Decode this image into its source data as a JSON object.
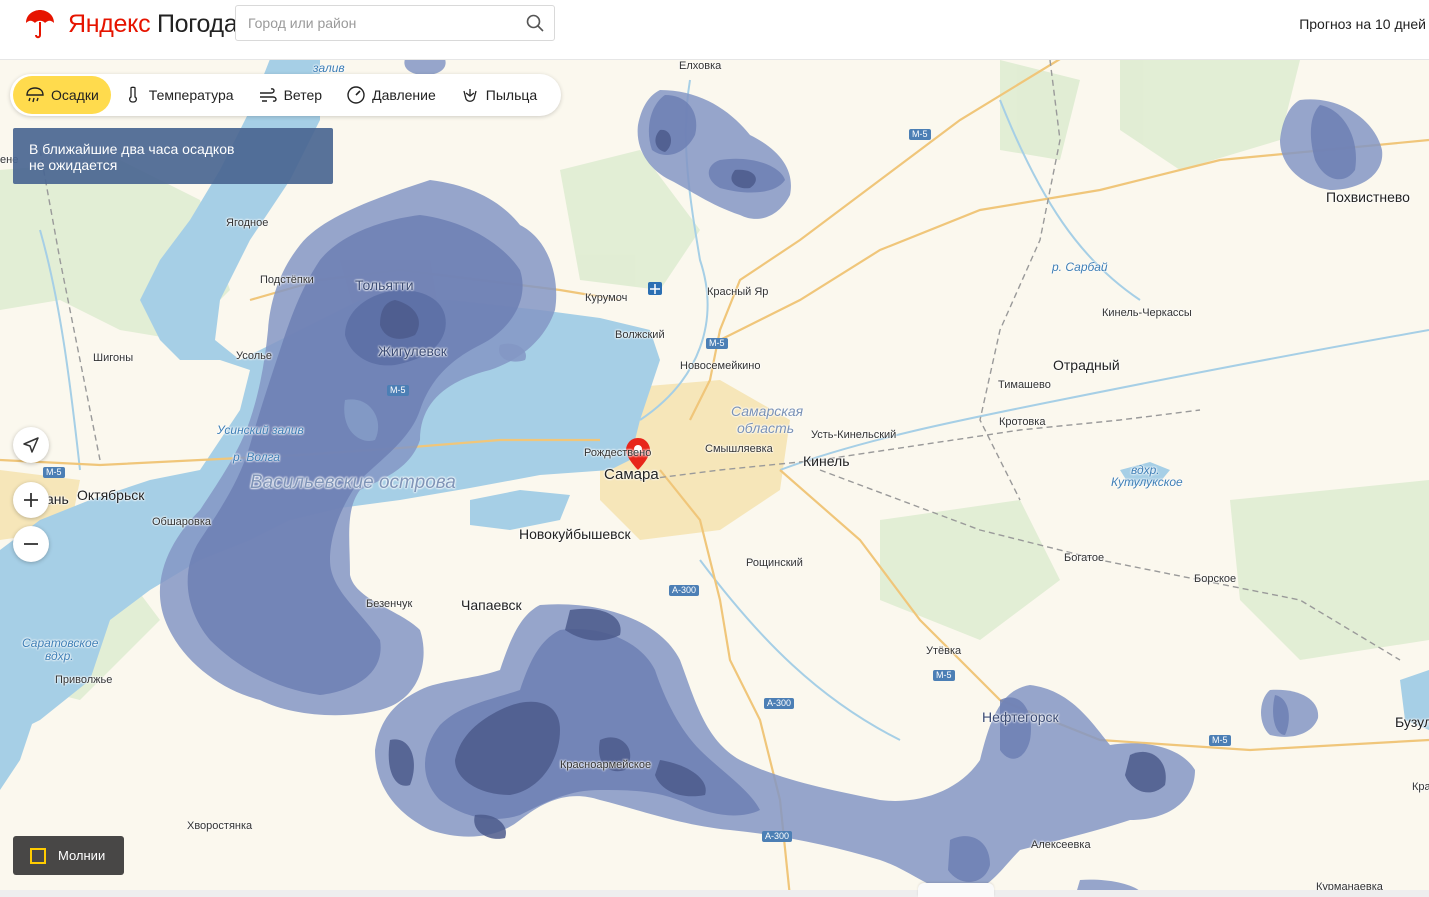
{
  "header": {
    "brand": "Яндекс",
    "product": "Погода",
    "search_placeholder": "Город или район",
    "forecast_link": "Прогноз на 10 дней"
  },
  "tabs": [
    {
      "label": "Осадки",
      "icon": "umbrella-rain-icon",
      "active": true
    },
    {
      "label": "Температура",
      "icon": "thermometer-icon",
      "active": false
    },
    {
      "label": "Ветер",
      "icon": "wind-icon",
      "active": false
    },
    {
      "label": "Давление",
      "icon": "pressure-gauge-icon",
      "active": false
    },
    {
      "label": "Пыльца",
      "icon": "pollen-icon",
      "active": false
    }
  ],
  "info": {
    "line1": "В ближайшие два часа осадков",
    "line2": "не ожидается"
  },
  "controls": {
    "lightning_label": "Молнии"
  },
  "map": {
    "labels": {
      "samara": "Самара",
      "rozhdestveno": "Рождествено",
      "novokuybyshevsk": "Новокуйбышевск",
      "chapaevsk": "Чапаевск",
      "tolyatti": "Тольятти",
      "zhigulevsk": "Жигулевск",
      "oktyabrsk": "Октябрьск",
      "otradny": "Отрадный",
      "kinel": "Кинель",
      "pokhvistnevo": "Похвистнево",
      "neftegorsk": "Нефтегорск",
      "kurumoch": "Курумоч",
      "krasny_yar": "Красный Яр",
      "volzhsky": "Волжский",
      "novosemeykino": "Новосемейкино",
      "smyshlyaevka": "Смышляевка",
      "ust_kinelsky": "Усть-Кинельский",
      "timashevo": "Тимашево",
      "krotovka": "Кротовка",
      "kinel_cherkassy": "Кинель-Черкассы",
      "bogatoe": "Богатое",
      "borskoe": "Борское",
      "roshchinsky": "Рощинский",
      "utevka": "Утёвка",
      "alekseevka": "Алексеевка",
      "krasnoarmeyskoe": "Красноармейское",
      "khvorostyanka": "Хворостянка",
      "bezenchuk": "Безенчук",
      "obsharovka": "Обшаровка",
      "privolzhye": "Приволжье",
      "shigony": "Шигоны",
      "usolye": "Усолье",
      "podstepki": "Подстёпки",
      "yagodnoe": "Ягодное",
      "elkhovka": "Елховка",
      "buzuluk": "Бузул",
      "kurmanaevka": "Курманаевка",
      "syzran_frag": "ань",
      "kr_frag": "Кра",
      "ene_frag": "ене",
      "samarskaya_oblast_1": "Самарская",
      "samarskaya_oblast_2": "область",
      "vasilyevskie": "Васильевские острова",
      "r_sarbay": "р. Сарбай",
      "vdkhr_kutuluk_1": "вдхр.",
      "vdkhr_kutuluk_2": "Кутулукское",
      "usinsky": "Усинский залив",
      "volga": "р. Волга",
      "saratov_1": "Саратовское",
      "saratov_2": "вдхр.",
      "zaliv": "залив"
    },
    "roads": {
      "m5": "M-5",
      "a300": "A-300"
    }
  }
}
